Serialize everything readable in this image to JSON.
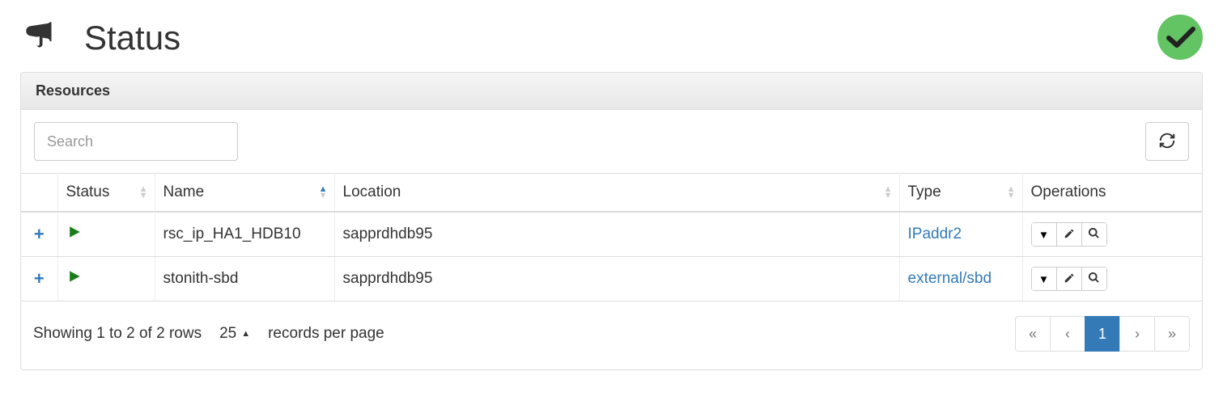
{
  "header": {
    "title": "Status"
  },
  "panel": {
    "title": "Resources",
    "search_placeholder": "Search"
  },
  "columns": {
    "status": "Status",
    "name": "Name",
    "location": "Location",
    "type": "Type",
    "operations": "Operations"
  },
  "rows": [
    {
      "name": "rsc_ip_HA1_HDB10",
      "location": "sapprdhdb95",
      "type": "IPaddr2"
    },
    {
      "name": "stonith-sbd",
      "location": "sapprdhdb95",
      "type": "external/sbd"
    }
  ],
  "footer": {
    "summary": "Showing 1 to 2 of 2 rows",
    "page_size": "25",
    "records_label": "records per page",
    "current_page": "1"
  }
}
